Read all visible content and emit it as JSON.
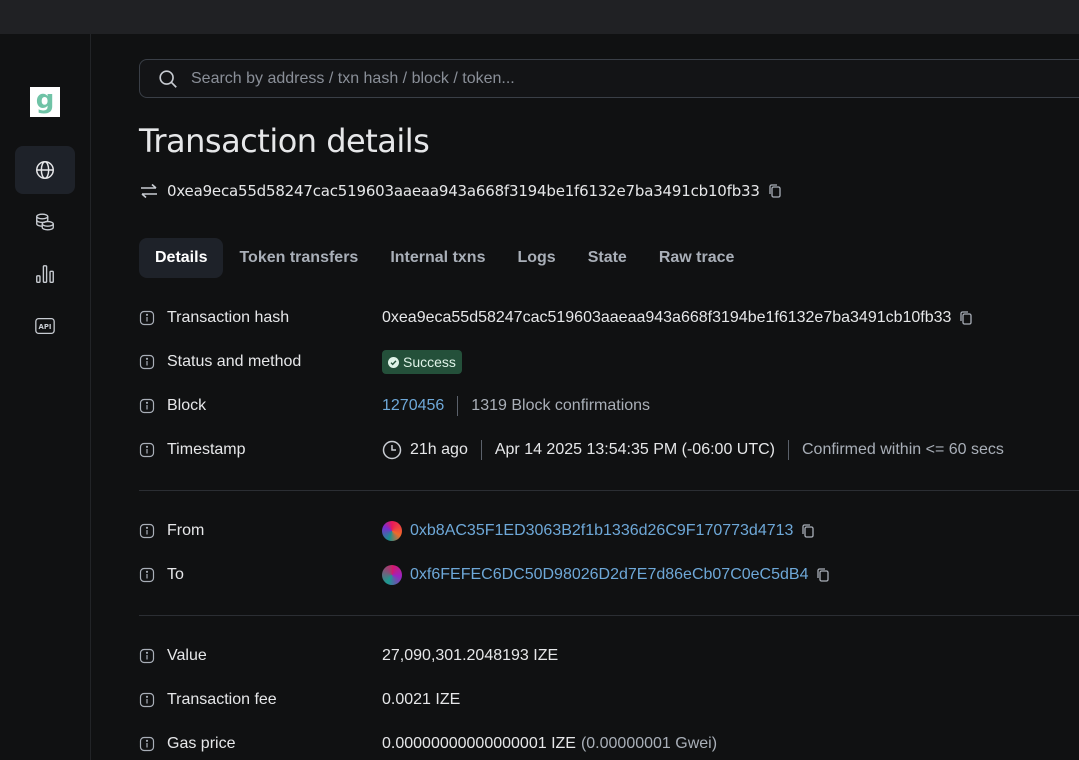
{
  "search": {
    "placeholder": "Search by address / txn hash / block / token..."
  },
  "page": {
    "title": "Transaction details",
    "hash": "0xea9eca55d58247cac519603aaeaa943a668f3194be1f6132e7ba3491cb10fb33"
  },
  "logo": {
    "letter": "g"
  },
  "nav": {
    "items": [
      {
        "icon": "globe-icon",
        "active": true
      },
      {
        "icon": "coins-icon",
        "active": false
      },
      {
        "icon": "chart-bars-icon",
        "active": false
      },
      {
        "icon": "api-icon",
        "active": false
      }
    ]
  },
  "tabs": [
    {
      "label": "Details",
      "active": true
    },
    {
      "label": "Token transfers",
      "active": false
    },
    {
      "label": "Internal txns",
      "active": false
    },
    {
      "label": "Logs",
      "active": false
    },
    {
      "label": "State",
      "active": false
    },
    {
      "label": "Raw trace",
      "active": false
    }
  ],
  "details": {
    "tx_hash": {
      "label": "Transaction hash",
      "value": "0xea9eca55d58247cac519603aaeaa943a668f3194be1f6132e7ba3491cb10fb33"
    },
    "status": {
      "label": "Status and method",
      "value": "Success"
    },
    "block": {
      "label": "Block",
      "number": "1270456",
      "confirmations": "1319 Block confirmations"
    },
    "timestamp": {
      "label": "Timestamp",
      "ago": "21h ago",
      "date": "Apr 14 2025 13:54:35 PM (-06:00 UTC)",
      "confirmed": "Confirmed within <= 60 secs"
    },
    "from": {
      "label": "From",
      "address": "0xb8AC35F1ED3063B2f1b1336d26C9F170773d4713"
    },
    "to": {
      "label": "To",
      "address": "0xf6FEFEC6DC50D98026D2d7E7d86eCb07C0eC5dB4"
    },
    "value": {
      "label": "Value",
      "value": "27,090,301.2048193 IZE"
    },
    "fee": {
      "label": "Transaction fee",
      "value": "0.0021 IZE"
    },
    "gas_price": {
      "label": "Gas price",
      "value": "0.00000000000000001 IZE",
      "gwei": "(0.00000001 Gwei)"
    }
  },
  "colors": {
    "background": "#101112",
    "topbar": "#202124",
    "link": "#6ea8d8",
    "success_badge": "#24503a"
  }
}
